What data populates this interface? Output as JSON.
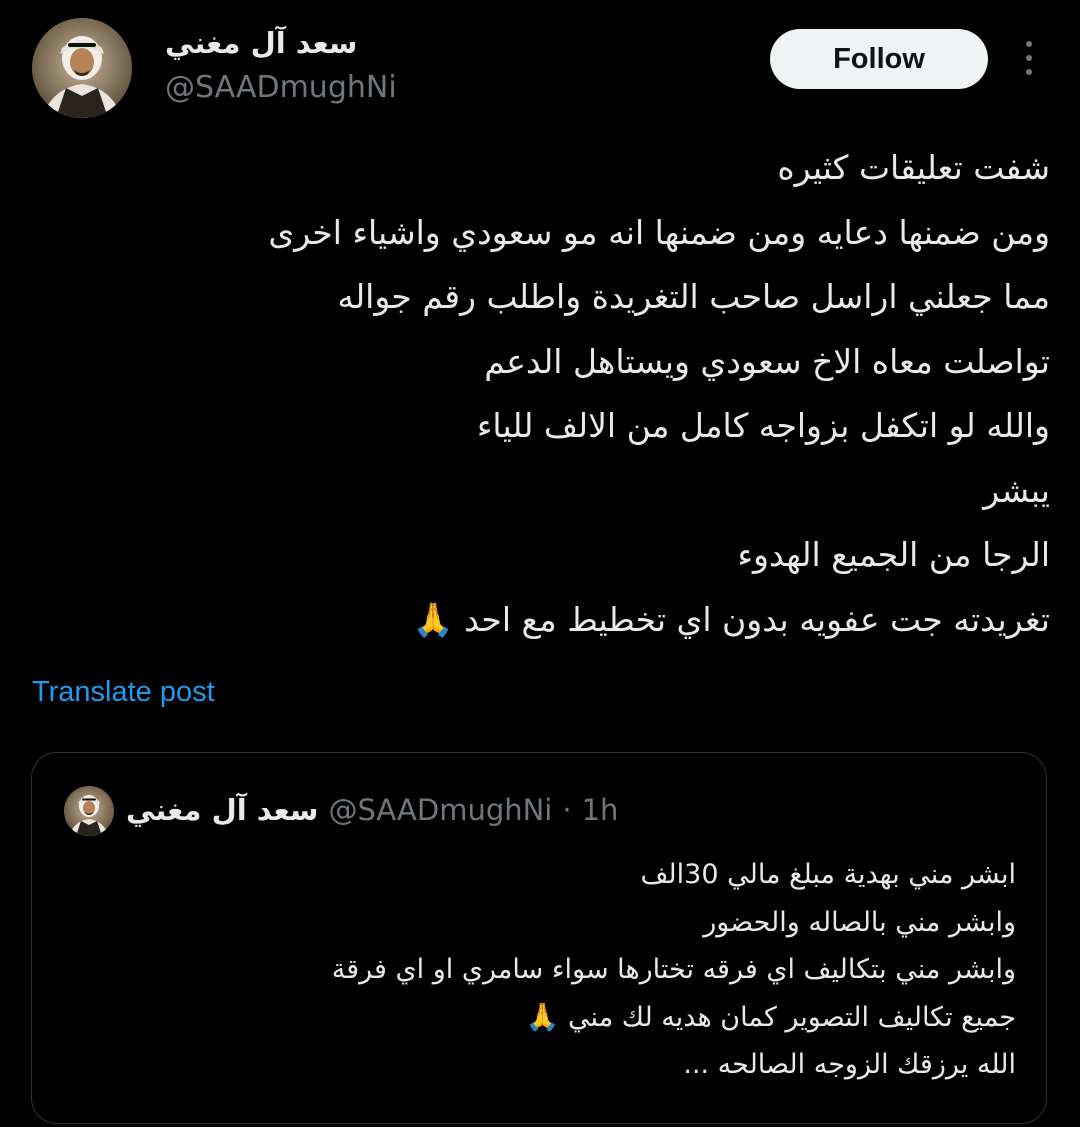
{
  "post": {
    "author_name": "سعد آل مغني",
    "author_handle": "@SAADmughNi",
    "follow_label": "Follow",
    "text_lines": [
      "شفت تعليقات كثيره",
      "ومن ضمنها دعايه ومن ضمنها انه مو سعودي واشياء اخرى",
      "مما جعلني اراسل صاحب التغريدة واطلب رقم جواله",
      "تواصلت معاه الاخ سعودي ويستاهل الدعم",
      "والله لو اتكفل بزواجه كامل من الالف للياء",
      "يبشر",
      "الرجا من الجميع الهدوء",
      "تغريدته جت عفويه بدون اي تخطيط مع احد 🙏"
    ],
    "translate_label": "Translate post"
  },
  "quote": {
    "author_name": "سعد آل مغني",
    "author_handle": "@SAADmughNi",
    "separator": "·",
    "time": "1h",
    "text_lines": [
      "ابشر مني بهدية مبلغ مالي 30الف",
      "وابشر مني بالصاله والحضور",
      "وابشر مني بتكاليف اي فرقه تختارها سواء سامري او اي فرقة",
      "جميع تكاليف التصوير كمان هديه لك مني 🙏",
      "الله يرزقك الزوجه الصالحه ..."
    ]
  },
  "icons": {
    "more": "more-vertical-icon",
    "avatar": "profile-avatar"
  },
  "colors": {
    "background": "#000000",
    "text_primary": "#e7e9ea",
    "text_secondary": "#71767b",
    "link": "#1d9bf0",
    "border": "#2f3336",
    "follow_bg": "#eff3f4"
  }
}
